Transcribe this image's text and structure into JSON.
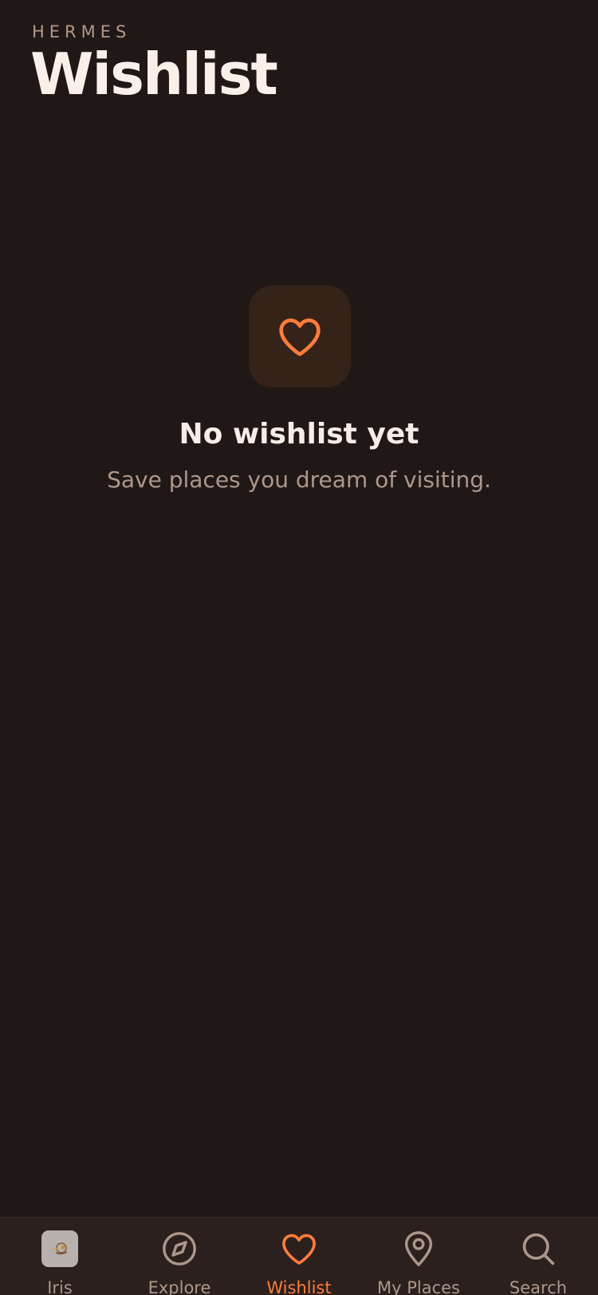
{
  "header": {
    "brand": "HERMES",
    "title": "Wishlist"
  },
  "empty_state": {
    "icon": "heart-icon",
    "title": "No wishlist yet",
    "subtitle": "Save places you dream of visiting."
  },
  "tabs": [
    {
      "label": "Iris",
      "icon": "avatar-image",
      "active": false
    },
    {
      "label": "Explore",
      "icon": "compass-icon",
      "active": false
    },
    {
      "label": "Wishlist",
      "icon": "heart-icon",
      "active": true
    },
    {
      "label": "My Places",
      "icon": "location-pin-icon",
      "active": false
    },
    {
      "label": "Search",
      "icon": "search-icon",
      "active": false
    }
  ],
  "colors": {
    "background": "#201816",
    "accent": "#fb7d3d",
    "muted_text": "#ad978c",
    "tile": "#352219",
    "tabbar": "#2b201d"
  }
}
